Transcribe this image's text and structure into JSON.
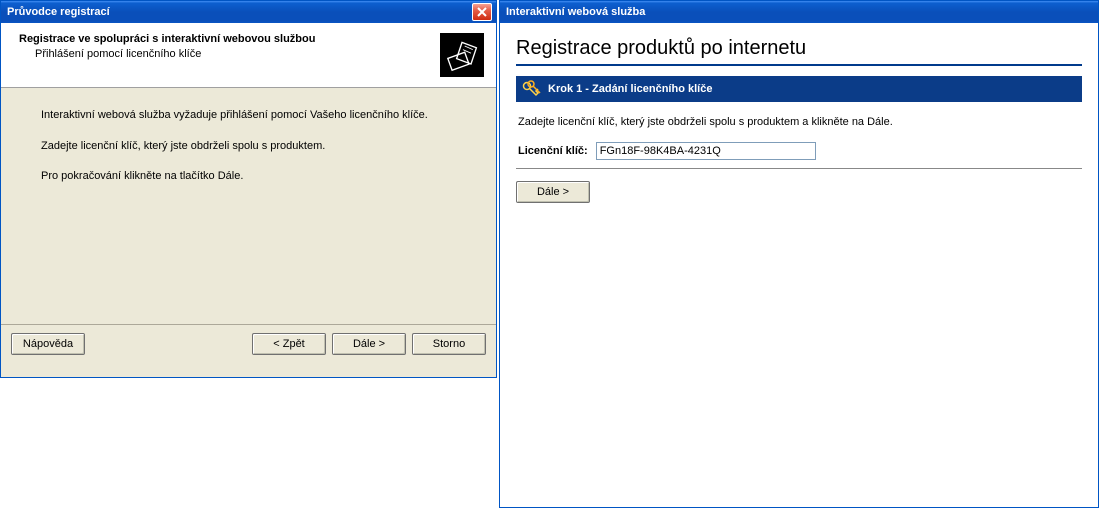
{
  "left": {
    "title": "Průvodce registrací",
    "header_title": "Registrace ve spolupráci s interaktivní webovou službou",
    "header_sub": "Přihlášení pomocí licenčního klíče",
    "body_line1": "Interaktivní webová služba vyžaduje přihlášení pomocí Vašeho licenčního klíče.",
    "body_line2": "Zadejte licenční klíč, který jste obdrželi spolu s produktem.",
    "body_line3": "Pro pokračování klikněte na tlačítko Dále.",
    "buttons": {
      "help": "Nápověda",
      "back": "< Zpět",
      "next": "Dále >",
      "cancel": "Storno"
    }
  },
  "right": {
    "title": "Interaktivní webová služba",
    "page_title": "Registrace produktů po internetu",
    "step_label": "Krok 1 - Zadání licenčního klíče",
    "instruction": "Zadejte licenční klíč, který jste obdrželi spolu s produktem a klikněte na Dále.",
    "lic_label": "Licenční klíč:",
    "lic_value": "FGn18F-98K4BA-4231Q",
    "next_btn": "Dále >"
  }
}
